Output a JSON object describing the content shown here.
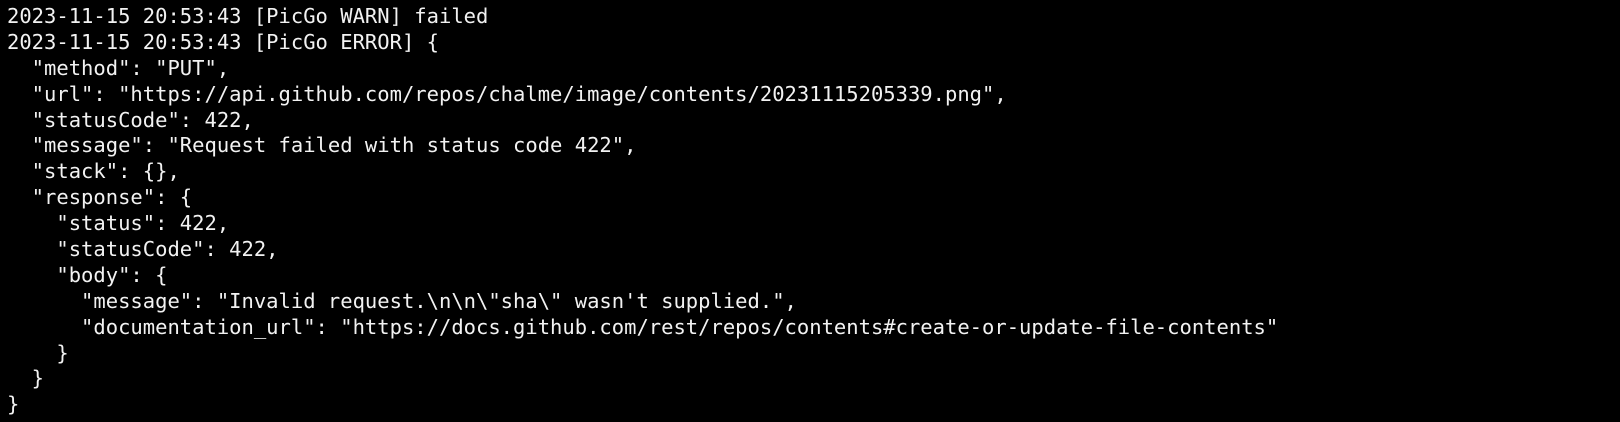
{
  "terminal": {
    "lines": [
      "2023-11-15 20:53:43 [PicGo WARN] failed",
      "2023-11-15 20:53:43 [PicGo ERROR] {",
      "  \"method\": \"PUT\",",
      "  \"url\": \"https://api.github.com/repos/chalme/image/contents/20231115205339.png\",",
      "  \"statusCode\": 422,",
      "  \"message\": \"Request failed with status code 422\",",
      "  \"stack\": {},",
      "  \"response\": {",
      "    \"status\": 422,",
      "    \"statusCode\": 422,",
      "    \"body\": {",
      "      \"message\": \"Invalid request.\\n\\n\\\"sha\\\" wasn't supplied.\",",
      "      \"documentation_url\": \"https://docs.github.com/rest/repos/contents#create-or-update-file-contents\"",
      "    }",
      "  }",
      "}"
    ]
  }
}
